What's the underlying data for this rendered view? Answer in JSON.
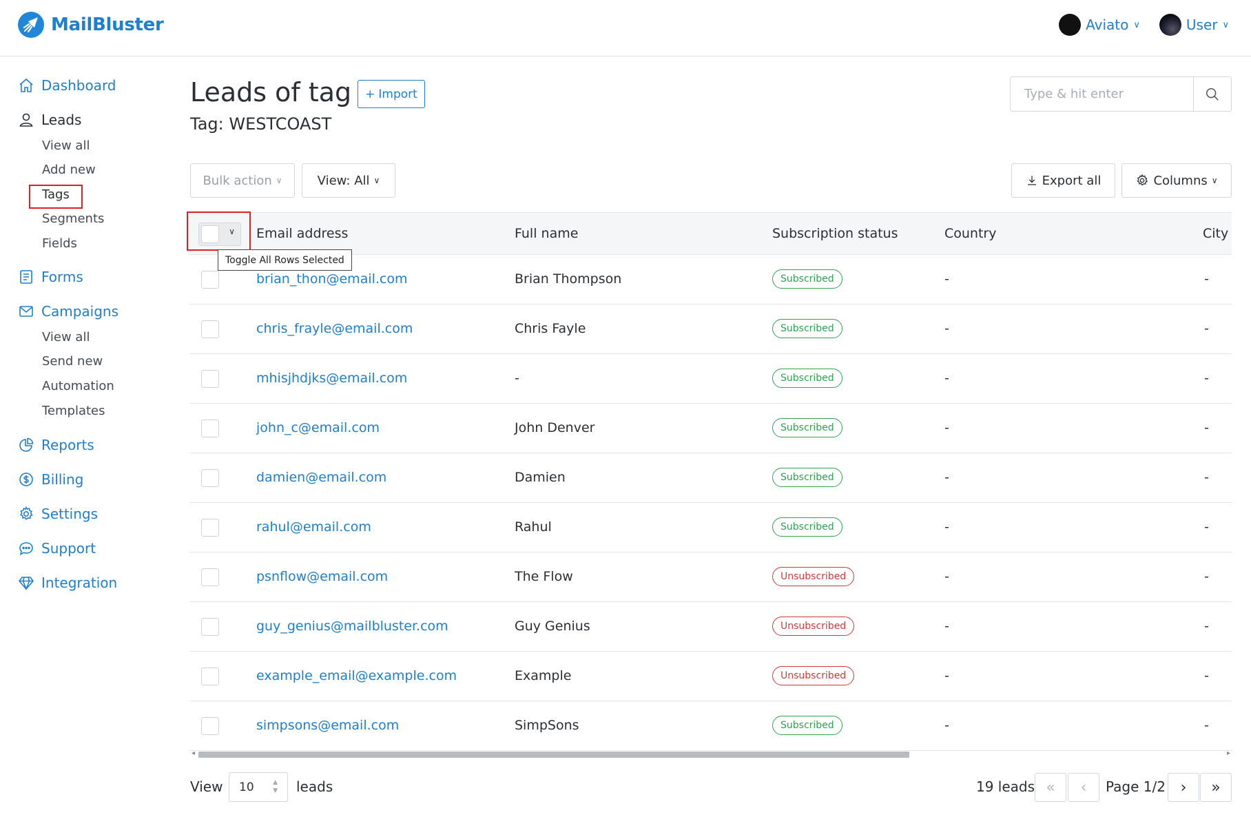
{
  "app": {
    "name": "MailBluster"
  },
  "topbar": {
    "org_label": "Aviato",
    "user_label": "User"
  },
  "sidebar": {
    "dashboard": "Dashboard",
    "leads": "Leads",
    "leads_items": [
      "View all",
      "Add new",
      "Tags",
      "Segments",
      "Fields"
    ],
    "forms": "Forms",
    "campaigns": "Campaigns",
    "campaign_items": [
      "View all",
      "Send new",
      "Automation",
      "Templates"
    ],
    "reports": "Reports",
    "billing": "Billing",
    "settings": "Settings",
    "support": "Support",
    "integration": "Integration"
  },
  "header": {
    "title": "Leads of tag",
    "import_label": "Import",
    "subtitle": "Tag: WESTCOAST",
    "search_placeholder": "Type & hit enter"
  },
  "toolbar": {
    "bulk_action": "Bulk action",
    "view_filter": "View: All",
    "export_all": "Export all",
    "columns": "Columns"
  },
  "table": {
    "columns": [
      "Email address",
      "Full name",
      "Subscription status",
      "Country",
      "City"
    ],
    "tooltip": "Toggle All Rows Selected",
    "rows": [
      {
        "email": "brian_thon@email.com",
        "name": "Brian Thompson",
        "status": "Subscribed",
        "country": "-",
        "city": "-"
      },
      {
        "email": "chris_frayle@email.com",
        "name": "Chris Fayle",
        "status": "Subscribed",
        "country": "-",
        "city": "-"
      },
      {
        "email": "mhisjhdjks@email.com",
        "name": "-",
        "status": "Subscribed",
        "country": "-",
        "city": "-"
      },
      {
        "email": "john_c@email.com",
        "name": "John Denver",
        "status": "Subscribed",
        "country": "-",
        "city": "-"
      },
      {
        "email": "damien@email.com",
        "name": "Damien",
        "status": "Subscribed",
        "country": "-",
        "city": "-"
      },
      {
        "email": "rahul@email.com",
        "name": "Rahul",
        "status": "Subscribed",
        "country": "-",
        "city": "-"
      },
      {
        "email": "psnflow@email.com",
        "name": "The Flow",
        "status": "Unsubscribed",
        "country": "-",
        "city": "-"
      },
      {
        "email": "guy_genius@mailbluster.com",
        "name": "Guy Genius",
        "status": "Unsubscribed",
        "country": "-",
        "city": "-"
      },
      {
        "email": "example_email@example.com",
        "name": "Example",
        "status": "Unsubscribed",
        "country": "-",
        "city": "-"
      },
      {
        "email": "simpsons@email.com",
        "name": "SimpSons",
        "status": "Subscribed",
        "country": "-",
        "city": "-"
      }
    ]
  },
  "footer": {
    "view_label": "View",
    "page_size": "10",
    "leads_label": "leads",
    "count": "19 leads",
    "page": "Page 1/2"
  },
  "colors": {
    "brand": "#1f7fcf",
    "subscribed": "#2ea44f",
    "unsubscribed": "#d73a3a",
    "highlight": "#e02020"
  }
}
